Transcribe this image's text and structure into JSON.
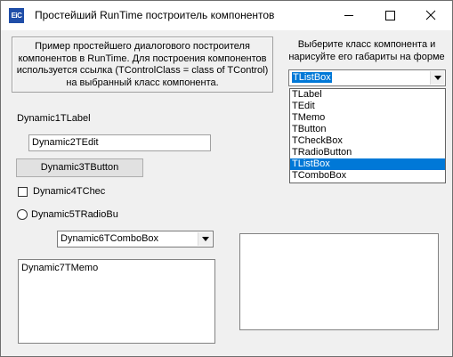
{
  "window": {
    "title": "Простейший RunTime построитель компонентов",
    "icon_text": "EiC"
  },
  "info": {
    "lines": [
      "Пример простейшего диалогового построителя",
      "компонентов в RunTime. Для построения компонентов",
      "используется ссылка (TControlClass = class of TControl)",
      "на выбранный класс компонента."
    ]
  },
  "chooser": {
    "label_lines": [
      "Выберите класс компонента и",
      "нарисуйте его габариты на форме"
    ],
    "selected": "TListBox",
    "options": [
      "TLabel",
      "TEdit",
      "TMemo",
      "TButton",
      "TCheckBox",
      "TRadioButton",
      "TListBox",
      "TComboBox"
    ],
    "selected_index": 6
  },
  "dynamic": {
    "label": "Dynamic1TLabel",
    "edit": "Dynamic2TEdit",
    "button": "Dynamic3TButton",
    "checkbox": "Dynamic4TChec",
    "radio": "Dynamic5TRadioBu",
    "combo": "Dynamic6TComboBox",
    "memo": "Dynamic7TMemo"
  }
}
